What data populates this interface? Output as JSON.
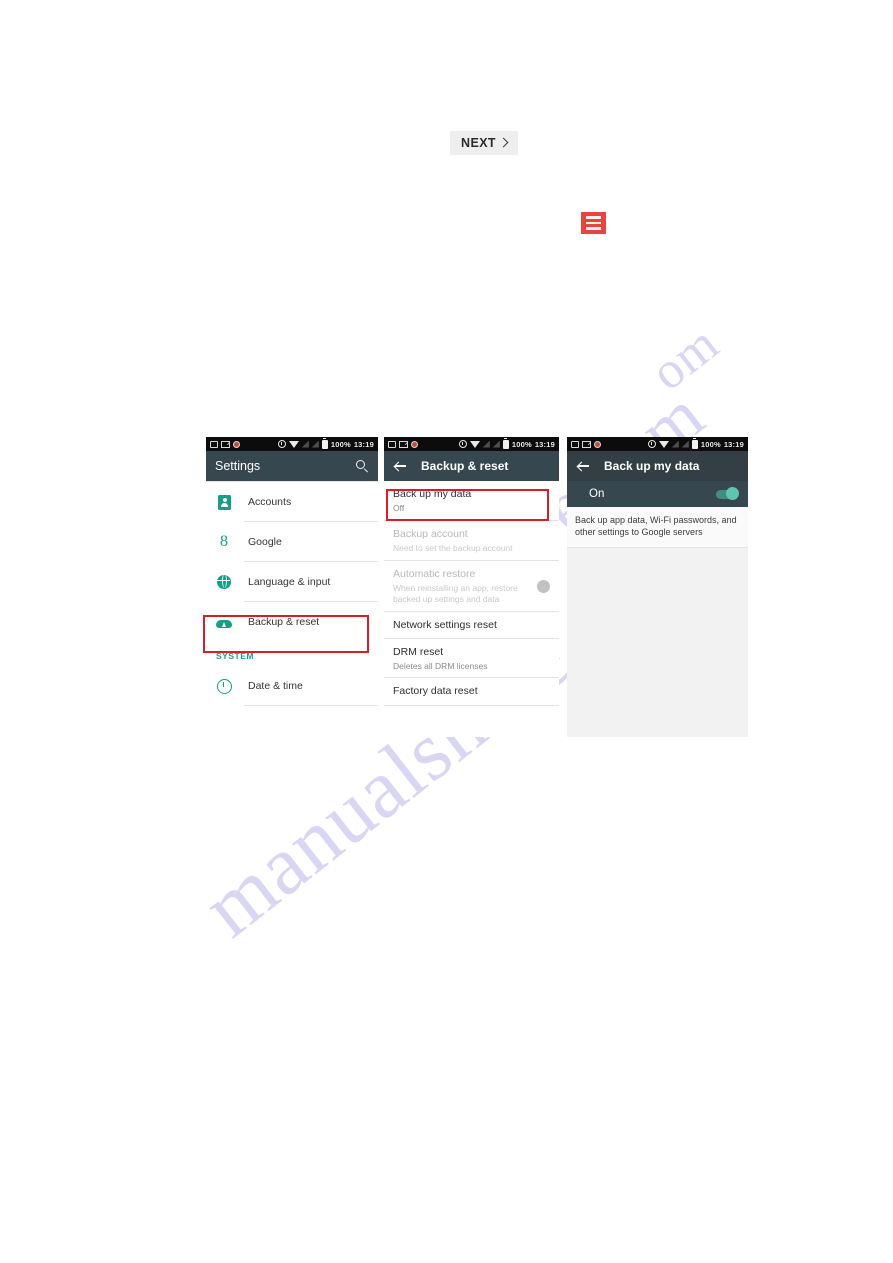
{
  "watermark": {
    "top": "om",
    "middle": "shive.com",
    "bottom": "manualshive.com"
  },
  "nav": {
    "next_label": "NEXT",
    "next_chevron_icon": "chevron-right-icon",
    "menu_icon": "hamburger-menu-icon",
    "menu_color": "#e8463c"
  },
  "colors": {
    "toolbar": "#37474f",
    "accent_teal": "#13a085",
    "highlight_red": "#d81f26",
    "statusbar": "#0c0c0c"
  },
  "statusbar": {
    "left_icons": [
      "screenshot-icon",
      "mail-icon",
      "alarm-red-icon"
    ],
    "right_icons": [
      "clock-icon",
      "wifi-icon",
      "signal-icon",
      "signal-icon",
      "battery-icon"
    ],
    "battery": "100%",
    "time": "13:19"
  },
  "phone1": {
    "title": "Settings",
    "search_icon": "search-icon",
    "items": [
      {
        "label": "Accounts",
        "icon": "accounts-icon"
      },
      {
        "label": "Google",
        "icon": "google-g-icon"
      },
      {
        "label": "Language & input",
        "icon": "globe-icon"
      },
      {
        "label": "Backup & reset",
        "icon": "cloud-upload-icon",
        "highlighted": true
      }
    ],
    "section_header": "SYSTEM",
    "section_items": [
      {
        "label": "Date & time",
        "icon": "clock-face-icon"
      }
    ]
  },
  "phone2": {
    "title": "Backup & reset",
    "back_icon": "back-arrow-icon",
    "items": [
      {
        "title": "Back up my data",
        "subtitle": "Off",
        "disabled": false,
        "highlighted": true
      },
      {
        "title": "Backup account",
        "subtitle": "Need to set the backup account",
        "disabled": true
      },
      {
        "title": "Automatic restore",
        "subtitle": "When reinstalling an app, restore backed up settings and data",
        "disabled": true,
        "toggle": "off"
      },
      {
        "title": "Network settings reset",
        "subtitle": "",
        "disabled": false
      },
      {
        "title": "DRM reset",
        "subtitle": "Deletes all DRM licenses",
        "disabled": false
      },
      {
        "title": "Factory data reset",
        "subtitle": "",
        "disabled": false
      }
    ]
  },
  "phone3": {
    "title": "Back up my data",
    "back_icon": "back-arrow-icon",
    "toggle_label": "On",
    "toggle_state": "on",
    "description": "Back up app data, Wi-Fi passwords, and other settings to Google servers"
  }
}
